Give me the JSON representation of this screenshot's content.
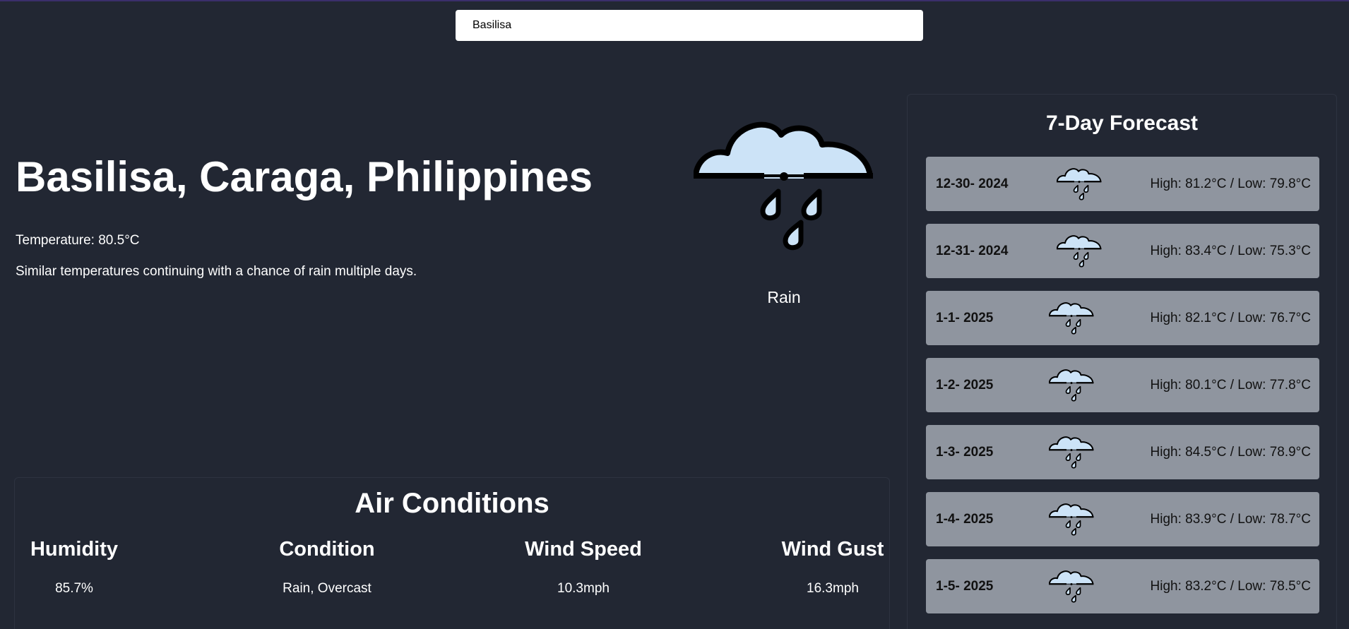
{
  "search": {
    "value": "Basilisa"
  },
  "current": {
    "location": "Basilisa, Caraga, Philippines",
    "temperature": "Temperature: 80.5°C",
    "summary": "Similar temperatures continuing with a chance of rain multiple days.",
    "condition": "Rain",
    "icon": "rain-cloud-icon"
  },
  "air_conditions": {
    "title": "Air Conditions",
    "items": [
      {
        "label": "Humidity",
        "value": "85.7%"
      },
      {
        "label": "Condition",
        "value": "Rain, Overcast"
      },
      {
        "label": "Wind Speed",
        "value": "10.3mph"
      },
      {
        "label": "Wind Gust",
        "value": "16.3mph"
      }
    ]
  },
  "forecast": {
    "title": "7-Day Forecast",
    "days": [
      {
        "date": "12-30- 2024",
        "temps": "High: 81.2°C / Low: 79.8°C",
        "icon": "rain-cloud-icon"
      },
      {
        "date": "12-31- 2024",
        "temps": "High: 83.4°C / Low: 75.3°C",
        "icon": "rain-cloud-icon"
      },
      {
        "date": "1-1- 2025",
        "temps": "High: 82.1°C / Low: 76.7°C",
        "icon": "rain-cloud-icon"
      },
      {
        "date": "1-2- 2025",
        "temps": "High: 80.1°C / Low: 77.8°C",
        "icon": "rain-cloud-icon"
      },
      {
        "date": "1-3- 2025",
        "temps": "High: 84.5°C / Low: 78.9°C",
        "icon": "rain-cloud-icon"
      },
      {
        "date": "1-4- 2025",
        "temps": "High: 83.9°C / Low: 78.7°C",
        "icon": "rain-cloud-icon"
      },
      {
        "date": "1-5- 2025",
        "temps": "High: 83.2°C / Low: 78.5°C",
        "icon": "rain-cloud-icon"
      }
    ]
  },
  "colors": {
    "background": "#222733",
    "forecast_row": "#8f959f",
    "cloud_fill": "#cce3f7",
    "outline": "#000000"
  }
}
